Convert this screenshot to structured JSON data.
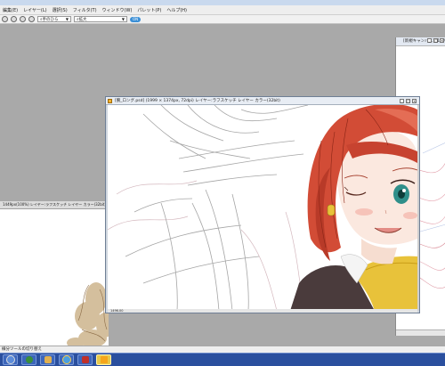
{
  "menu": {
    "items": [
      {
        "label": "編集(E)"
      },
      {
        "label": "レイヤー(L)"
      },
      {
        "label": "選択(S)"
      },
      {
        "label": "フィルタ(T)"
      },
      {
        "label": "ウィンドウ(W)"
      },
      {
        "label": "パレット(P)"
      },
      {
        "label": "ヘルプ(H)"
      }
    ]
  },
  "toolbar": {
    "tool_combo": "手のひら",
    "zoom_combo": "拡大",
    "pill_label": "ON"
  },
  "right_panel": {
    "title": "[新規キャンバス] (1:1/0.5)"
  },
  "left_window": {
    "title": "1449px(100%) レイヤー:ラフスケッチ レイヤー カラー(32bit)"
  },
  "main_window": {
    "title": "[腕_ロング.psd] (1999 × 1374px, 72dpi) レイヤー:ラフスケッチ レイヤー カラー(32bit)",
    "status": "1496.00"
  },
  "status_bar": {
    "text": "線分ツールの切り替え"
  },
  "taskbar": {
    "apps": [
      {
        "icon": "start-icon"
      },
      {
        "icon": "globe-icon"
      },
      {
        "icon": "paint-icon"
      },
      {
        "icon": "browser-icon"
      },
      {
        "icon": "security-icon"
      },
      {
        "icon": "trophy-icon"
      }
    ]
  },
  "colors": {
    "accent": "#3b8fd6",
    "taskbar": "#2a4f9e",
    "hair": "#d9503a"
  }
}
